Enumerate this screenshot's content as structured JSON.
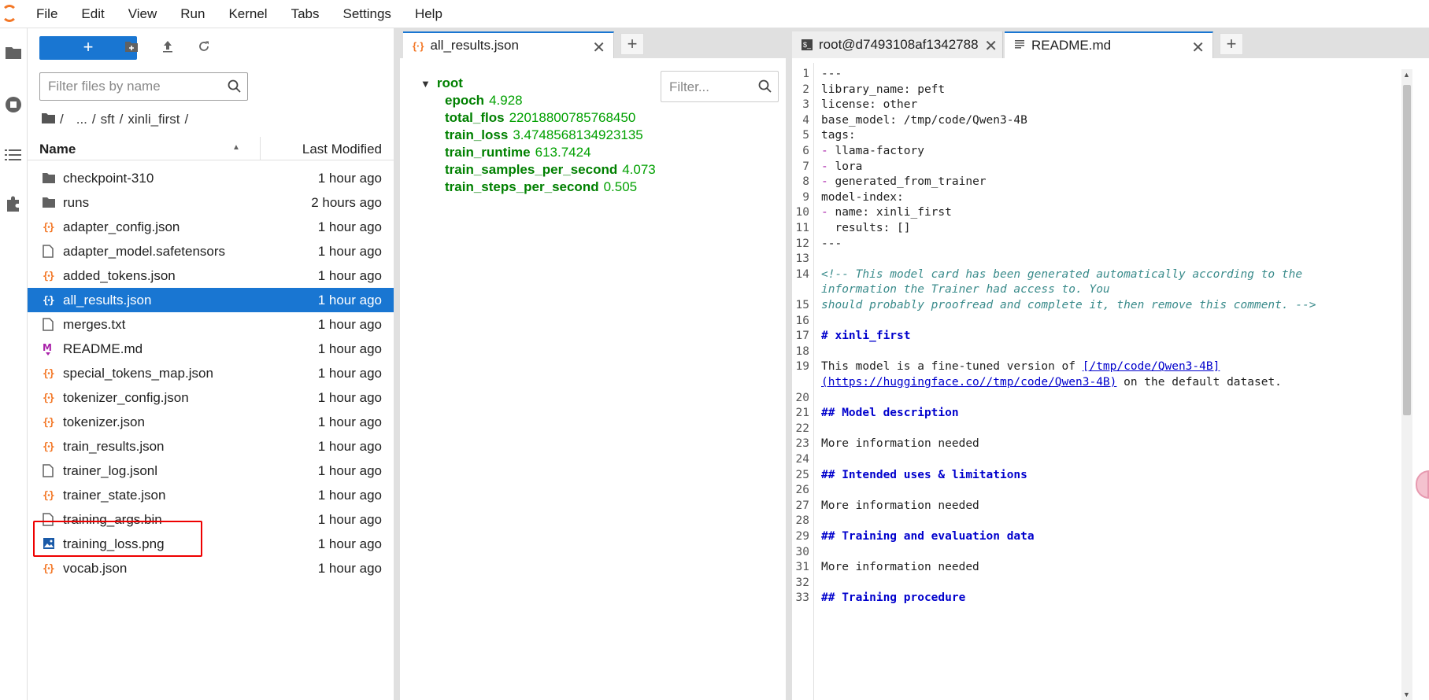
{
  "menubar": {
    "items": [
      "File",
      "Edit",
      "View",
      "Run",
      "Kernel",
      "Tabs",
      "Settings",
      "Help"
    ]
  },
  "filebrowser": {
    "new_label": "+",
    "filter_placeholder": "Filter files by name",
    "breadcrumbs": [
      "/",
      "...",
      "/",
      "sft",
      "/",
      "xinli_first",
      "/"
    ],
    "header_name": "Name",
    "header_modified": "Last Modified",
    "files": [
      {
        "name": "checkpoint-310",
        "modified": "1 hour ago",
        "icon": "folder-icon"
      },
      {
        "name": "runs",
        "modified": "2 hours ago",
        "icon": "folder-icon"
      },
      {
        "name": "adapter_config.json",
        "modified": "1 hour ago",
        "icon": "json-icon"
      },
      {
        "name": "adapter_model.safetensors",
        "modified": "1 hour ago",
        "icon": "file-icon"
      },
      {
        "name": "added_tokens.json",
        "modified": "1 hour ago",
        "icon": "json-icon"
      },
      {
        "name": "all_results.json",
        "modified": "1 hour ago",
        "icon": "json-icon",
        "selected": true
      },
      {
        "name": "merges.txt",
        "modified": "1 hour ago",
        "icon": "file-icon"
      },
      {
        "name": "README.md",
        "modified": "1 hour ago",
        "icon": "markdown-icon"
      },
      {
        "name": "special_tokens_map.json",
        "modified": "1 hour ago",
        "icon": "json-icon"
      },
      {
        "name": "tokenizer_config.json",
        "modified": "1 hour ago",
        "icon": "json-icon"
      },
      {
        "name": "tokenizer.json",
        "modified": "1 hour ago",
        "icon": "json-icon"
      },
      {
        "name": "train_results.json",
        "modified": "1 hour ago",
        "icon": "json-icon"
      },
      {
        "name": "trainer_log.jsonl",
        "modified": "1 hour ago",
        "icon": "file-icon"
      },
      {
        "name": "trainer_state.json",
        "modified": "1 hour ago",
        "icon": "json-icon"
      },
      {
        "name": "training_args.bin",
        "modified": "1 hour ago",
        "icon": "file-icon"
      },
      {
        "name": "training_loss.png",
        "modified": "1 hour ago",
        "icon": "image-icon"
      },
      {
        "name": "vocab.json",
        "modified": "1 hour ago",
        "icon": "json-icon"
      }
    ]
  },
  "json_tab": {
    "title": "all_results.json",
    "filter_placeholder": "Filter...",
    "root_label": "root",
    "entries": [
      {
        "key": "epoch",
        "value": "4.928"
      },
      {
        "key": "total_flos",
        "value": "22018800785768450"
      },
      {
        "key": "train_loss",
        "value": "3.4748568134923135"
      },
      {
        "key": "train_runtime",
        "value": "613.7424"
      },
      {
        "key": "train_samples_per_second",
        "value": "4.073"
      },
      {
        "key": "train_steps_per_second",
        "value": "0.505"
      }
    ]
  },
  "right_tabs": {
    "terminal_title": "root@d7493108af1342788",
    "readme_title": "README.md"
  },
  "readme_lines": [
    {
      "n": "1",
      "t": "---"
    },
    {
      "n": "2",
      "t": "library_name: peft"
    },
    {
      "n": "3",
      "t": "license: other"
    },
    {
      "n": "4",
      "t": "base_model: /tmp/code/Qwen3-4B"
    },
    {
      "n": "5",
      "t": "tags:"
    },
    {
      "n": "6",
      "d": "- ",
      "t": "llama-factory"
    },
    {
      "n": "7",
      "d": "- ",
      "t": "lora"
    },
    {
      "n": "8",
      "d": "- ",
      "t": "generated_from_trainer"
    },
    {
      "n": "9",
      "t": "model-index:"
    },
    {
      "n": "10",
      "d": "- ",
      "t": "name: xinli_first"
    },
    {
      "n": "11",
      "t": "  results: []"
    },
    {
      "n": "12",
      "t": "---"
    },
    {
      "n": "13",
      "t": ""
    },
    {
      "n": "14",
      "t": "<!-- This model card has been generated automatically according to the",
      "c": "cmt"
    },
    {
      "n": "",
      "t": "information the Trainer had access to. You",
      "c": "cmt"
    },
    {
      "n": "15",
      "t": "should probably proofread and complete it, then remove this comment. -->",
      "c": "cmt"
    },
    {
      "n": "16",
      "t": ""
    },
    {
      "n": "17",
      "t": "# xinli_first",
      "c": "hdr"
    },
    {
      "n": "18",
      "t": ""
    },
    {
      "n": "19",
      "t": "This model is a fine-tuned version of ",
      "link1": "[/tmp/code/Qwen3-4B]"
    },
    {
      "n": "",
      "link2": "(https://huggingface.co//tmp/code/Qwen3-4B)",
      "t2": " on the default dataset."
    },
    {
      "n": "20",
      "t": ""
    },
    {
      "n": "21",
      "t": "## Model description",
      "c": "hdr"
    },
    {
      "n": "22",
      "t": ""
    },
    {
      "n": "23",
      "t": "More information needed"
    },
    {
      "n": "24",
      "t": ""
    },
    {
      "n": "25",
      "t": "## Intended uses & limitations",
      "c": "hdr"
    },
    {
      "n": "26",
      "t": ""
    },
    {
      "n": "27",
      "t": "More information needed"
    },
    {
      "n": "28",
      "t": ""
    },
    {
      "n": "29",
      "t": "## Training and evaluation data",
      "c": "hdr"
    },
    {
      "n": "30",
      "t": ""
    },
    {
      "n": "31",
      "t": "More information needed"
    },
    {
      "n": "32",
      "t": ""
    },
    {
      "n": "33",
      "t": "## Training procedure",
      "c": "hdr"
    }
  ],
  "colors": {
    "accent": "#1976d2",
    "json_icon": "#f37726",
    "markdown_icon": "#aa22aa",
    "highlight": "#ee0000"
  }
}
